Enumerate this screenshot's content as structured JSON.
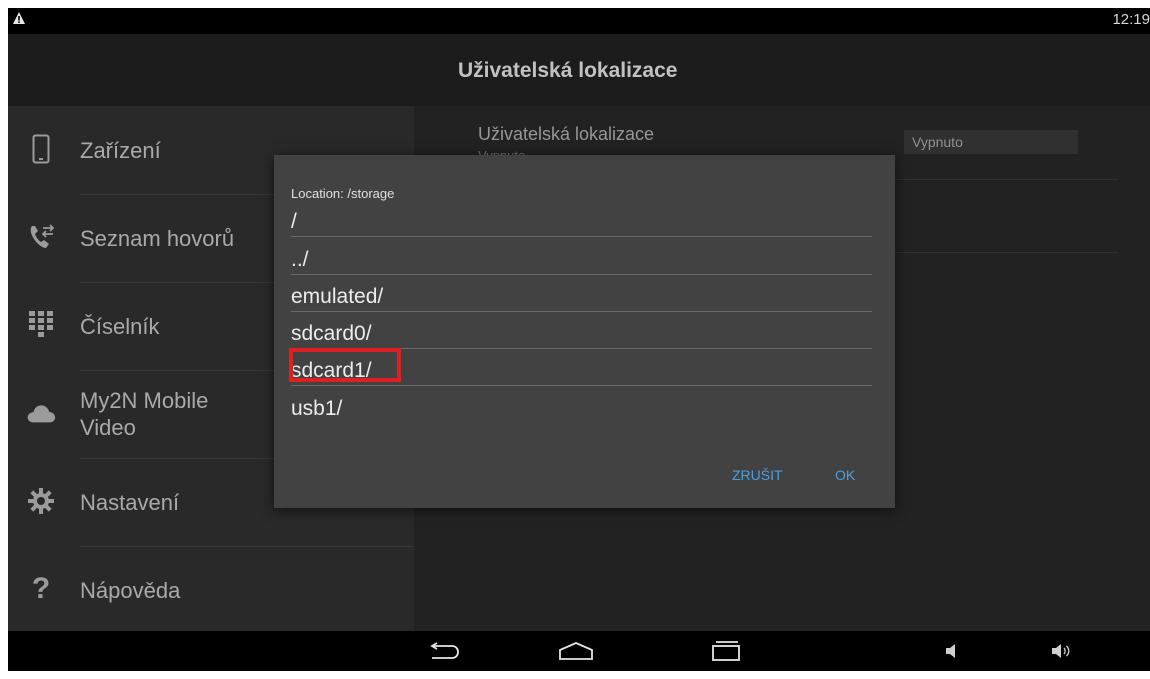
{
  "status_bar": {
    "time": "12:19",
    "warning_icon": "warning-icon"
  },
  "action_bar": {
    "title": "Uživatelská lokalizace"
  },
  "sidebar": {
    "items": [
      {
        "label": "Zařízení",
        "icon": "phone-device-icon"
      },
      {
        "label": "Seznam hovorů",
        "icon": "call-log-icon"
      },
      {
        "label": "Číselník",
        "icon": "dialpad-icon"
      },
      {
        "label": "My2N Mobile Video",
        "icon": "cloud-icon"
      },
      {
        "label": "Nastavení",
        "icon": "gear-icon"
      },
      {
        "label": "Nápověda",
        "icon": "help-icon"
      }
    ]
  },
  "settings_pane": {
    "setting_title": "Uživatelská lokalizace",
    "setting_subtitle": "Vypnuto",
    "setting_value": "Vypnuto"
  },
  "dialog": {
    "location": "Location: /storage",
    "entries": [
      "/",
      "../",
      "emulated/",
      "sdcard0/",
      "sdcard1/",
      "usb1/"
    ],
    "highlighted_entry": "sdcard1/",
    "cancel_label": "ZRUŠIT",
    "ok_label": "OK"
  },
  "nav_bar": {
    "buttons": [
      "back-icon",
      "home-icon",
      "recents-icon",
      "volume-down-icon",
      "volume-up-icon"
    ]
  },
  "colors": {
    "accent": "#4a9fe0",
    "highlight": "#e01f22"
  }
}
